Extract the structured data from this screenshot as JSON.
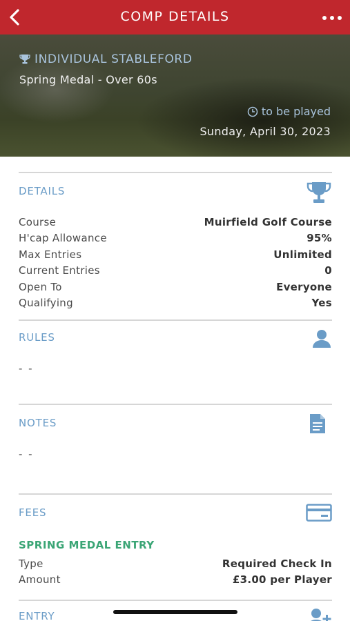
{
  "header": {
    "title": "COMP DETAILS",
    "back_icon": "chevron-left-icon",
    "more_icon": "more-horizontal-icon",
    "color": "#c0272d"
  },
  "hero": {
    "format": "INDIVIDUAL STABLEFORD",
    "format_icon": "trophy-icon",
    "competition_name": "Spring Medal - Over 60s",
    "status": "to be played",
    "status_icon": "clock-icon",
    "date": "Sunday, April 30, 2023"
  },
  "details": {
    "label": "DETAILS",
    "icon": "trophy-icon",
    "rows": [
      {
        "key": "Course",
        "value": "Muirfield Golf Course"
      },
      {
        "key": "H'cap Allowance",
        "value": "95%"
      },
      {
        "key": "Max Entries",
        "value": "Unlimited"
      },
      {
        "key": "Current Entries",
        "value": "0"
      },
      {
        "key": "Open To",
        "value": "Everyone"
      },
      {
        "key": "Qualifying",
        "value": "Yes"
      }
    ]
  },
  "rules": {
    "label": "RULES",
    "icon": "person-icon",
    "value": "- -"
  },
  "notes": {
    "label": "NOTES",
    "icon": "document-icon",
    "value": "- -"
  },
  "fees": {
    "label": "FEES",
    "icon": "credit-card-icon",
    "fee_title": "SPRING MEDAL ENTRY",
    "rows": [
      {
        "key": "Type",
        "value": "Required Check In"
      },
      {
        "key": "Amount",
        "value": "£3.00 per Player"
      }
    ]
  },
  "entry": {
    "label": "ENTRY",
    "icon": "add-person-icon"
  },
  "colors": {
    "accent_blue": "#6a9cc7",
    "fee_green": "#3aa575",
    "divider": "#d6d6d6"
  }
}
